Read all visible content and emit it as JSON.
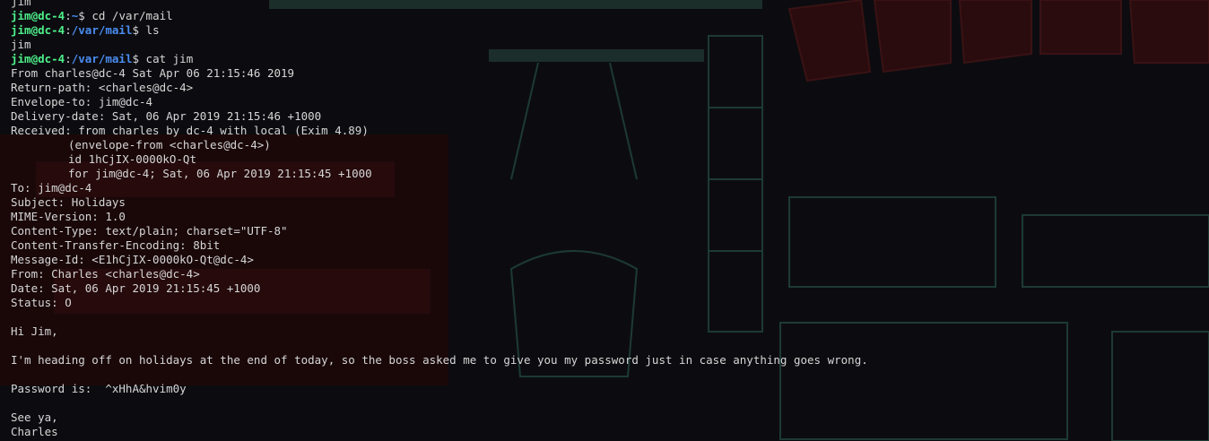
{
  "terminal": {
    "lines": [
      {
        "type": "output",
        "text": "jim"
      },
      {
        "type": "prompt",
        "user": "jim@dc-4",
        "sep": ":",
        "path": "~",
        "dollar": "$ ",
        "cmd": "cd /var/mail"
      },
      {
        "type": "prompt",
        "user": "jim@dc-4",
        "sep": ":",
        "path": "/var/mail",
        "dollar": "$ ",
        "cmd": "ls"
      },
      {
        "type": "output",
        "text": "jim"
      },
      {
        "type": "prompt",
        "user": "jim@dc-4",
        "sep": ":",
        "path": "/var/mail",
        "dollar": "$ ",
        "cmd": "cat jim"
      },
      {
        "type": "output",
        "text": "From charles@dc-4 Sat Apr 06 21:15:46 2019"
      },
      {
        "type": "output",
        "text": "Return-path: <charles@dc-4>"
      },
      {
        "type": "output",
        "text": "Envelope-to: jim@dc-4"
      },
      {
        "type": "output",
        "text": "Delivery-date: Sat, 06 Apr 2019 21:15:46 +1000"
      },
      {
        "type": "output",
        "text": "Received: from charles by dc-4 with local (Exim 4.89)"
      },
      {
        "type": "indent",
        "text": "(envelope-from <charles@dc-4>)"
      },
      {
        "type": "indent",
        "text": "id 1hCjIX-0000kO-Qt"
      },
      {
        "type": "indent",
        "text": "for jim@dc-4; Sat, 06 Apr 2019 21:15:45 +1000"
      },
      {
        "type": "output",
        "text": "To: jim@dc-4"
      },
      {
        "type": "output",
        "text": "Subject: Holidays"
      },
      {
        "type": "output",
        "text": "MIME-Version: 1.0"
      },
      {
        "type": "output",
        "text": "Content-Type: text/plain; charset=\"UTF-8\""
      },
      {
        "type": "output",
        "text": "Content-Transfer-Encoding: 8bit"
      },
      {
        "type": "output",
        "text": "Message-Id: <E1hCjIX-0000kO-Qt@dc-4>"
      },
      {
        "type": "output",
        "text": "From: Charles <charles@dc-4>"
      },
      {
        "type": "output",
        "text": "Date: Sat, 06 Apr 2019 21:15:45 +1000"
      },
      {
        "type": "output",
        "text": "Status: O"
      },
      {
        "type": "output",
        "text": ""
      },
      {
        "type": "output",
        "text": "Hi Jim,"
      },
      {
        "type": "output",
        "text": ""
      },
      {
        "type": "output",
        "text": "I'm heading off on holidays at the end of today, so the boss asked me to give you my password just in case anything goes wrong."
      },
      {
        "type": "output",
        "text": ""
      },
      {
        "type": "output",
        "text": "Password is:  ^xHhA&hvim0y"
      },
      {
        "type": "output",
        "text": ""
      },
      {
        "type": "output",
        "text": "See ya,"
      },
      {
        "type": "output",
        "text": "Charles"
      }
    ]
  },
  "colors": {
    "user": "#4ef08a",
    "path": "#4a8cf0",
    "text": "#d6d6d6",
    "background": "#0c0c10"
  }
}
